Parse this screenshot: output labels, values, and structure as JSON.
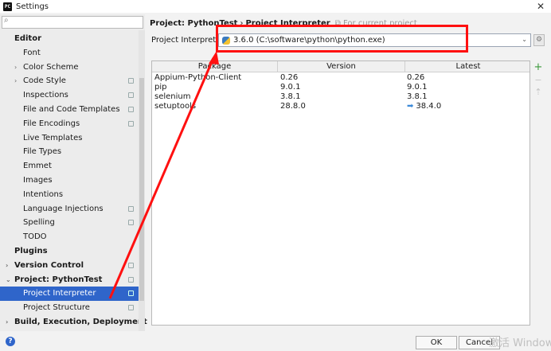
{
  "window": {
    "title": "Settings",
    "app_icon": "PC"
  },
  "sidebar": {
    "search_placeholder": "",
    "items": [
      {
        "label": "Editor",
        "level": 0,
        "bold": true,
        "arrow": "",
        "badge": false,
        "selected": false
      },
      {
        "label": "Font",
        "level": 1,
        "bold": false,
        "arrow": "",
        "badge": false,
        "selected": false
      },
      {
        "label": "Color Scheme",
        "level": 1,
        "bold": false,
        "arrow": "›",
        "badge": false,
        "selected": false
      },
      {
        "label": "Code Style",
        "level": 1,
        "bold": false,
        "arrow": "›",
        "badge": true,
        "selected": false
      },
      {
        "label": "Inspections",
        "level": 1,
        "bold": false,
        "arrow": "",
        "badge": true,
        "selected": false
      },
      {
        "label": "File and Code Templates",
        "level": 1,
        "bold": false,
        "arrow": "",
        "badge": true,
        "selected": false
      },
      {
        "label": "File Encodings",
        "level": 1,
        "bold": false,
        "arrow": "",
        "badge": true,
        "selected": false
      },
      {
        "label": "Live Templates",
        "level": 1,
        "bold": false,
        "arrow": "",
        "badge": false,
        "selected": false
      },
      {
        "label": "File Types",
        "level": 1,
        "bold": false,
        "arrow": "",
        "badge": false,
        "selected": false
      },
      {
        "label": "Emmet",
        "level": 1,
        "bold": false,
        "arrow": "",
        "badge": false,
        "selected": false
      },
      {
        "label": "Images",
        "level": 1,
        "bold": false,
        "arrow": "",
        "badge": false,
        "selected": false
      },
      {
        "label": "Intentions",
        "level": 1,
        "bold": false,
        "arrow": "",
        "badge": false,
        "selected": false
      },
      {
        "label": "Language Injections",
        "level": 1,
        "bold": false,
        "arrow": "",
        "badge": true,
        "selected": false
      },
      {
        "label": "Spelling",
        "level": 1,
        "bold": false,
        "arrow": "",
        "badge": true,
        "selected": false
      },
      {
        "label": "TODO",
        "level": 1,
        "bold": false,
        "arrow": "",
        "badge": false,
        "selected": false
      },
      {
        "label": "Plugins",
        "level": 0,
        "bold": true,
        "arrow": "",
        "badge": false,
        "selected": false
      },
      {
        "label": "Version Control",
        "level": 0,
        "bold": true,
        "arrow": "›",
        "badge": true,
        "selected": false
      },
      {
        "label": "Project: PythonTest",
        "level": 0,
        "bold": true,
        "arrow": "⌄",
        "badge": true,
        "selected": false
      },
      {
        "label": "Project Interpreter",
        "level": 1,
        "bold": false,
        "arrow": "",
        "badge": true,
        "selected": true
      },
      {
        "label": "Project Structure",
        "level": 1,
        "bold": false,
        "arrow": "",
        "badge": true,
        "selected": false
      },
      {
        "label": "Build, Execution, Deployment",
        "level": 0,
        "bold": true,
        "arrow": "›",
        "badge": false,
        "selected": false
      }
    ]
  },
  "main": {
    "breadcrumb": {
      "project": "Project: PythonTest",
      "separator": "›",
      "page": "Project Interpreter",
      "note": "For current project"
    },
    "interpreter_label": "Project Interpreter:",
    "interpreter_value": "3.6.0 (C:\\software\\python\\python.exe)",
    "table": {
      "columns": [
        "Package",
        "Version",
        "Latest"
      ],
      "rows": [
        {
          "package": "Appium-Python-Client",
          "version": "0.26",
          "latest": "0.26",
          "upgrade": false
        },
        {
          "package": "pip",
          "version": "9.0.1",
          "latest": "9.0.1",
          "upgrade": false
        },
        {
          "package": "selenium",
          "version": "3.8.1",
          "latest": "3.8.1",
          "upgrade": false
        },
        {
          "package": "setuptools",
          "version": "28.8.0",
          "latest": "38.4.0",
          "upgrade": true
        }
      ]
    },
    "tools": {
      "add": "+",
      "remove": "−",
      "upgrade": "⇡"
    }
  },
  "footer": {
    "ok_label": "OK",
    "cancel_label": "Cancel",
    "watermark": "激活 Window"
  },
  "colors": {
    "selection": "#2f65ca",
    "annotation": "#ff1010",
    "upgrade_arrow": "#3b89d8",
    "add_icon": "#3c9a3c"
  }
}
